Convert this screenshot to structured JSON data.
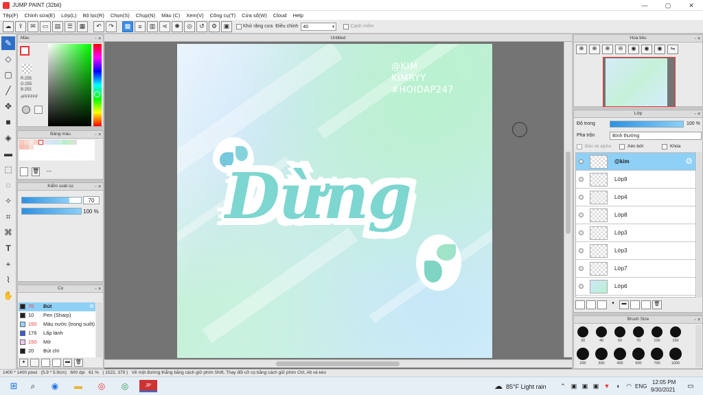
{
  "window": {
    "title": "JUMP PAINT (32bit)",
    "min": "—",
    "max": "▢",
    "close": "✕"
  },
  "menu": [
    "Tệp(F)",
    "Chỉnh sửa(E)",
    "Lớp(L)",
    "Bộ lọc(R)",
    "Chọn(S)",
    "Chụp(N)",
    "Màu (C)",
    "Xem(V)",
    "Công cụ(T)",
    "Cửa sổ(W)",
    "Cloud",
    "Help"
  ],
  "toolbar": {
    "antialias_label": "Khử răng cưa",
    "adjust_label": "Điều chỉnh",
    "adjust_value": "40",
    "edge_label": "Cạnh mềm"
  },
  "color_panel": {
    "title": "Màu",
    "r": "R:255",
    "g": "G:255",
    "b": "B:255",
    "hex": "#FFFFFF"
  },
  "palette_panel": {
    "title": "Bảng màu",
    "more": "---"
  },
  "control_panel": {
    "title": "Kiểm soát cọ",
    "size_value": "70",
    "opacity_value": "100 %"
  },
  "brush_panel": {
    "title": "Cọ",
    "items": [
      {
        "size": "70",
        "name": "Bút",
        "color": "#222222"
      },
      {
        "size": "10",
        "name": "Pen (Sharp)",
        "color": "#222222"
      },
      {
        "size": "150",
        "name": "Màu nước (trong suốt)",
        "color": "#8fd3ff"
      },
      {
        "size": "176",
        "name": "Lấp lánh",
        "color": "#3a5bd8"
      },
      {
        "size": "150",
        "name": "Mờ",
        "color": "#f3c6f3"
      },
      {
        "size": "20",
        "name": "Bút chì",
        "color": "#222222"
      }
    ]
  },
  "document": {
    "tab_title": "Untitled",
    "watermark_lines": [
      "@KIM",
      "KIMRYY",
      "#HOIDAP247"
    ],
    "artwork_text": "Dừng"
  },
  "navigator": {
    "title": "Hoa tiêu"
  },
  "layer_panel": {
    "title": "Lớp",
    "opacity_label": "Độ trong",
    "opacity_value": "100 %",
    "blend_label": "Pha trộn",
    "blend_value": "Bình thường",
    "protect_alpha": "Bảo vệ alpha",
    "clipping": "Xén bớt",
    "lock": "Khóa",
    "layers": [
      "@kim",
      "Lớp9",
      "Lớp4",
      "Lớp8",
      "Lớp3",
      "Lớp3",
      "Lớp7",
      "Lớp6"
    ]
  },
  "brush_size_panel": {
    "title": "Brush Size",
    "sizes": [
      "30",
      "40",
      "50",
      "70",
      "100",
      "150",
      "200",
      "300",
      "400",
      "500",
      "700",
      "1000"
    ]
  },
  "status": {
    "dimensions": "1400 * 1400 pixel",
    "physical": "(5.9 * 5.9cm)",
    "dpi": "600 dpi",
    "zoom": "61 %",
    "cursor": "( 1522, 379 )",
    "hint": "Vẽ một đường thẳng bằng cách giữ phím Shift, Thay đổi cỡ cọ bằng cách giữ phím Ctrl, Alt và kéo"
  },
  "taskbar": {
    "weather": "85°F  Light rain",
    "lang": "ENG",
    "time": "12:05 PM",
    "date": "9/30/2021"
  },
  "colors": {
    "accent": "#3a8ee6",
    "selected_row": "#8fd0f7",
    "canvas_bg": "#747474"
  }
}
